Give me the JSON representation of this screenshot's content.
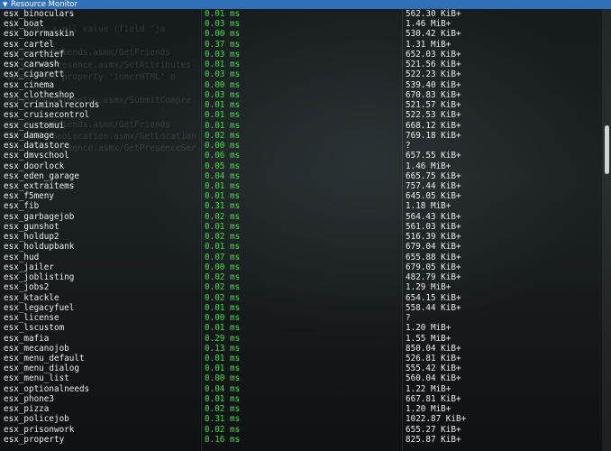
{
  "window": {
    "title": "Resource Monitor"
  },
  "ghost_lines": [
    "to index a nil value (field 'jo",
    "",
    "services/Friends.asmx/GetFriends",
    "services/Presence.asmx/SetAttributes",
    "Cannot set property 'innerHTML' o",
    "",
    "services/Telemetry.asmx/SubmitCompre",
    "",
    "services/Friends.asmx/GetFriends",
    "services/GeoLocation.asmx/GetLocation",
    "services/presence.asmx/GetPresenceSer"
  ],
  "resources": [
    {
      "name": "esx_binoculars",
      "cpu": "0.01 ms",
      "memory": "562.30 KiB+"
    },
    {
      "name": "esx_boat",
      "cpu": "0.03 ms",
      "memory": "1.46 MiB+"
    },
    {
      "name": "esx_borrmaskin",
      "cpu": "0.00 ms",
      "memory": "530.42 KiB+"
    },
    {
      "name": "esx_cartel",
      "cpu": "0.37 ms",
      "memory": "1.31 MiB+"
    },
    {
      "name": "esx_carthief",
      "cpu": "0.03 ms",
      "memory": "652.03 KiB+"
    },
    {
      "name": "esx_carwash",
      "cpu": "0.01 ms",
      "memory": "521.56 KiB+"
    },
    {
      "name": "esx_cigarett",
      "cpu": "0.03 ms",
      "memory": "522.23 KiB+"
    },
    {
      "name": "esx_cinema",
      "cpu": "0.00 ms",
      "memory": "539.40 KiB+"
    },
    {
      "name": "esx_clotheshop",
      "cpu": "0.03 ms",
      "memory": "670.83 KiB+"
    },
    {
      "name": "esx_criminalrecords",
      "cpu": "0.01 ms",
      "memory": "521.57 KiB+"
    },
    {
      "name": "esx_cruisecontrol",
      "cpu": "0.01 ms",
      "memory": "522.53 KiB+"
    },
    {
      "name": "esx_customui",
      "cpu": "0.01 ms",
      "memory": "668.12 KiB+"
    },
    {
      "name": "esx_damage",
      "cpu": "0.02 ms",
      "memory": "769.18 KiB+"
    },
    {
      "name": "esx_datastore",
      "cpu": "0.00 ms",
      "memory": "?"
    },
    {
      "name": "esx_dmvschool",
      "cpu": "0.06 ms",
      "memory": "657.55 KiB+"
    },
    {
      "name": "esx_doorlock",
      "cpu": "0.05 ms",
      "memory": "1.46 MiB+"
    },
    {
      "name": "esx_eden_garage",
      "cpu": "0.04 ms",
      "memory": "665.75 KiB+"
    },
    {
      "name": "esx_extraitems",
      "cpu": "0.01 ms",
      "memory": "757.44 KiB+"
    },
    {
      "name": "esx_f5meny",
      "cpu": "0.01 ms",
      "memory": "645.05 KiB+"
    },
    {
      "name": "esx_fib",
      "cpu": "0.31 ms",
      "memory": "1.18 MiB+"
    },
    {
      "name": "esx_garbagejob",
      "cpu": "0.02 ms",
      "memory": "564.43 KiB+"
    },
    {
      "name": "esx_gunshot",
      "cpu": "0.01 ms",
      "memory": "561.03 KiB+"
    },
    {
      "name": "esx_holdup2",
      "cpu": "0.02 ms",
      "memory": "516.39 KiB+"
    },
    {
      "name": "esx_holdupbank",
      "cpu": "0.01 ms",
      "memory": "679.04 KiB+"
    },
    {
      "name": "esx_hud",
      "cpu": "0.07 ms",
      "memory": "655.88 KiB+"
    },
    {
      "name": "esx_jailer",
      "cpu": "0.00 ms",
      "memory": "679.05 KiB+"
    },
    {
      "name": "esx_joblisting",
      "cpu": "0.02 ms",
      "memory": "482.79 KiB+"
    },
    {
      "name": "esx_jobs2",
      "cpu": "0.02 ms",
      "memory": "1.29 MiB+"
    },
    {
      "name": "esx_ktackle",
      "cpu": "0.02 ms",
      "memory": "654.15 KiB+"
    },
    {
      "name": "esx_legacyfuel",
      "cpu": "0.01 ms",
      "memory": "558.44 KiB+"
    },
    {
      "name": "esx_license",
      "cpu": "0.00 ms",
      "memory": "?"
    },
    {
      "name": "esx_lscustom",
      "cpu": "0.01 ms",
      "memory": "1.20 MiB+"
    },
    {
      "name": "esx_mafia",
      "cpu": "0.29 ms",
      "memory": "1.55 MiB+"
    },
    {
      "name": "esx_mecanojob",
      "cpu": "0.13 ms",
      "memory": "850.04 KiB+"
    },
    {
      "name": "esx_menu_default",
      "cpu": "0.01 ms",
      "memory": "526.81 KiB+"
    },
    {
      "name": "esx_menu_dialog",
      "cpu": "0.01 ms",
      "memory": "555.42 KiB+"
    },
    {
      "name": "esx_menu_list",
      "cpu": "0.00 ms",
      "memory": "560.04 KiB+"
    },
    {
      "name": "esx_optionalneeds",
      "cpu": "0.04 ms",
      "memory": "1.22 MiB+"
    },
    {
      "name": "esx_phone3",
      "cpu": "0.01 ms",
      "memory": "667.81 KiB+"
    },
    {
      "name": "esx_pizza",
      "cpu": "0.02 ms",
      "memory": "1.20 MiB+"
    },
    {
      "name": "esx_policejob",
      "cpu": "0.31 ms",
      "memory": "1022.87 KiB+"
    },
    {
      "name": "esx_prisonwork",
      "cpu": "0.02 ms",
      "memory": "655.27 KiB+"
    },
    {
      "name": "esx_property",
      "cpu": "0.16 ms",
      "memory": "825.87 KiB+"
    }
  ],
  "colors": {
    "titlebar": "#2f6fb7",
    "cpu_text": "#39e23a",
    "text": "#e8ecee"
  }
}
